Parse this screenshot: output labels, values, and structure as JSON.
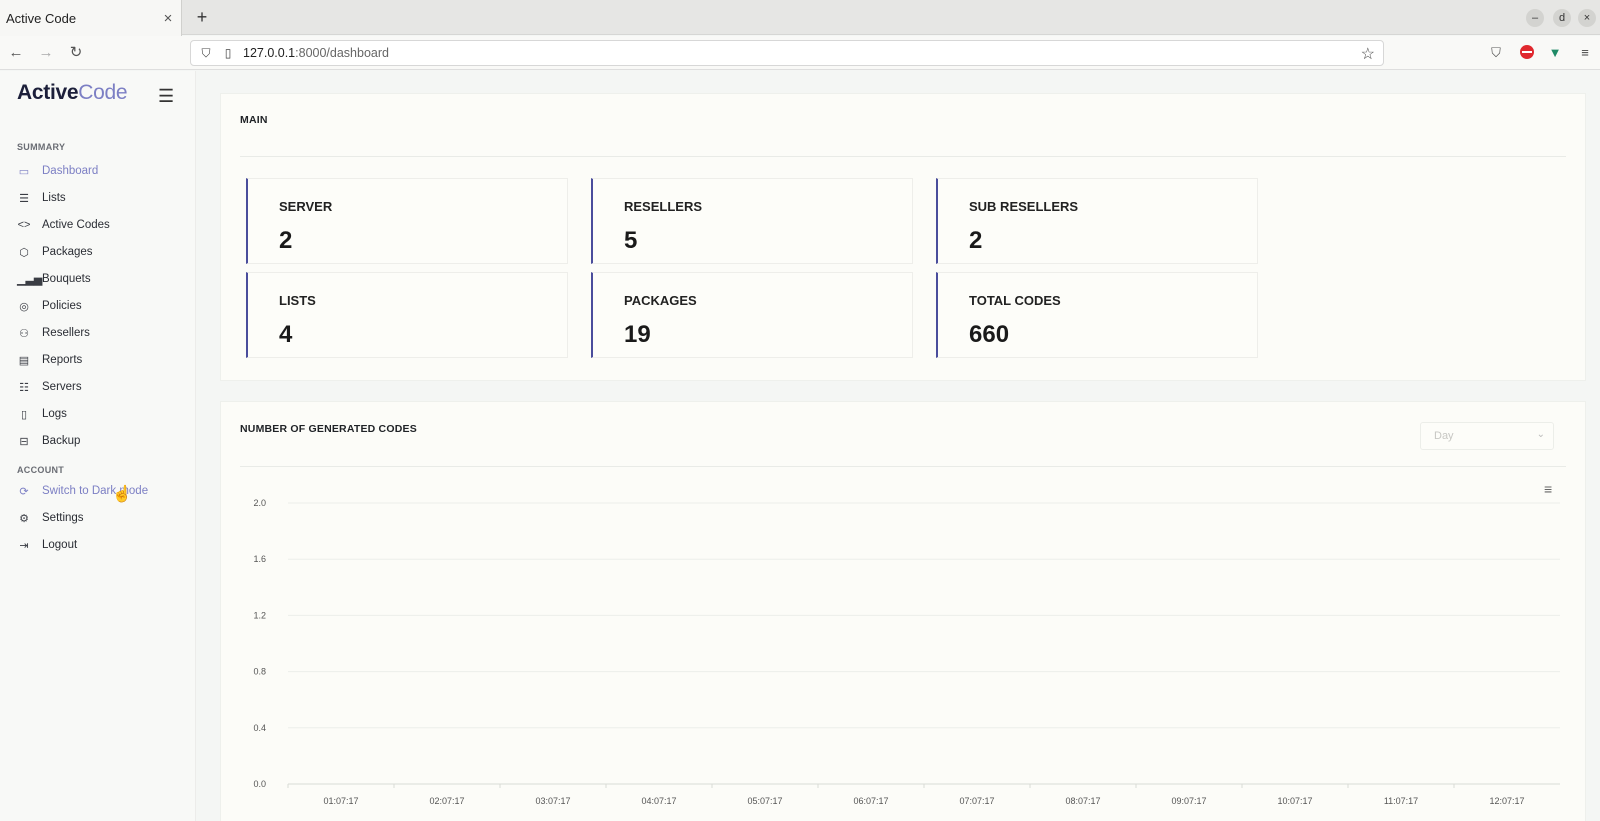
{
  "browser": {
    "tab_title": "Active Code",
    "tab_close": "×",
    "new_tab": "+",
    "url_host": "127.0.0.1",
    "url_path": ":8000/dashboard",
    "win_controls": [
      "–",
      "d",
      "×"
    ]
  },
  "sidebar": {
    "logo_main": "Active",
    "logo_accent": "Code",
    "summary_label": "SUMMARY",
    "summary_items": [
      {
        "label": "Dashboard",
        "icon": "monitor-icon"
      },
      {
        "label": "Lists",
        "icon": "list-icon"
      },
      {
        "label": "Active Codes",
        "icon": "code-icon"
      },
      {
        "label": "Packages",
        "icon": "box-icon"
      },
      {
        "label": "Bouquets",
        "icon": "bar-chart-icon"
      },
      {
        "label": "Policies",
        "icon": "aperture-icon"
      },
      {
        "label": "Resellers",
        "icon": "user-icon"
      },
      {
        "label": "Reports",
        "icon": "file-text-icon"
      },
      {
        "label": "Servers",
        "icon": "database-icon"
      },
      {
        "label": "Logs",
        "icon": "file-icon"
      },
      {
        "label": "Backup",
        "icon": "hard-drive-icon"
      }
    ],
    "account_label": "ACCOUNT",
    "account_items": [
      {
        "label": "Switch to Dark mode",
        "icon": "refresh-icon"
      },
      {
        "label": "Settings",
        "icon": "settings-icon"
      },
      {
        "label": "Logout",
        "icon": "log-out-icon"
      }
    ]
  },
  "main_panel": {
    "title": "MAIN",
    "stats": [
      {
        "label": "SERVER",
        "value": "2"
      },
      {
        "label": "RESELLERS",
        "value": "5"
      },
      {
        "label": "SUB RESELLERS",
        "value": "2"
      },
      {
        "label": "LISTS",
        "value": "4"
      },
      {
        "label": "PACKAGES",
        "value": "19"
      },
      {
        "label": "TOTAL CODES",
        "value": "660"
      }
    ]
  },
  "chart_panel": {
    "title": "NUMBER OF GENERATED CODES",
    "period_select": "Day"
  },
  "colors": {
    "accent": "#7c7fc4",
    "card_border": "#4a4d9c"
  },
  "chart_data": {
    "type": "line",
    "title": "NUMBER OF GENERATED CODES",
    "x": [
      "01:07:17",
      "02:07:17",
      "03:07:17",
      "04:07:17",
      "05:07:17",
      "06:07:17",
      "07:07:17",
      "08:07:17",
      "09:07:17",
      "10:07:17",
      "11:07:17",
      "12:07:17"
    ],
    "y_ticks": [
      "0.0",
      "0.4",
      "0.8",
      "1.2",
      "1.6",
      "2.0"
    ],
    "ylim": [
      0,
      2
    ],
    "grid": true,
    "series": []
  }
}
